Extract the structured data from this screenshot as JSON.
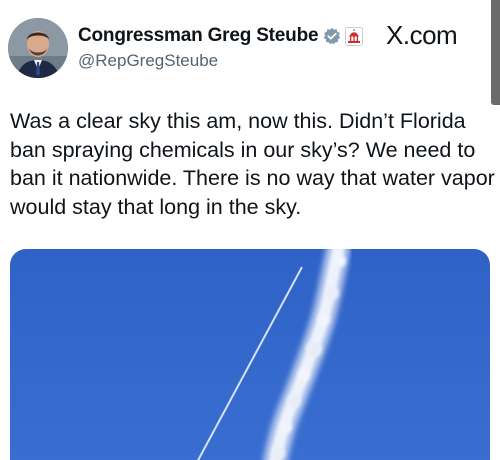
{
  "tweet": {
    "author": {
      "display_name": "Congressman Greg Steube",
      "handle": "@RepGregSteube",
      "avatar_icon": "profile-photo",
      "verified_icon": "gray-government-checkmark-icon",
      "affiliation_icon": "us-capitol-affiliation-icon"
    },
    "site_label": "X.com",
    "text": "Was a clear sky this am, now this.  Didn’t Florida ban spraying chemicals in our sky’s?  We need to ban it nationwide.  There is no way that water vapor would stay that long in the sky.",
    "media": {
      "description_icon": "sky-photo-contrail",
      "colors": {
        "sky_top": "#2f62c6",
        "sky_bottom": "#3a6fd1",
        "contrail": "#e8eef8"
      }
    }
  }
}
